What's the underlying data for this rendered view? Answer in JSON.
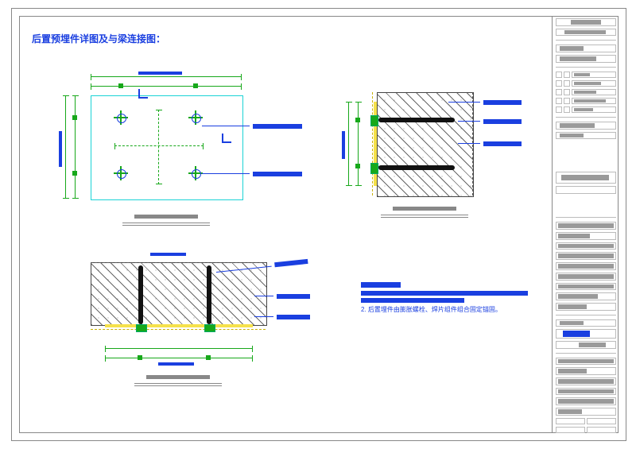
{
  "heading": "后置预埋件详图及与梁连接图：",
  "figA": {
    "caption_key": "plan_view_caption",
    "bolts": [
      "bolt-1",
      "bolt-2",
      "bolt-3",
      "bolt-4"
    ],
    "dim_top_label_key": "A_width",
    "dim_left_label_key": "A_height",
    "leaders": [
      "plate_label",
      "bolt_label"
    ]
  },
  "figB": {
    "caption_key": "side_section_caption",
    "leaders": [
      "anchor_label",
      "plate_label",
      "concrete_label"
    ]
  },
  "figC": {
    "caption_key": "bottom_section_caption",
    "leaders": [
      "anchor_label",
      "plate_label",
      "concrete_label"
    ]
  },
  "notes": {
    "title_key": "notes_heading",
    "item2": "2. 后置埋件由膨胀螺栓、焊片组件组合固定锚固。"
  },
  "colors": {
    "dim_green": "#17a81a",
    "line_blue": "#1a3fe0",
    "plate_cyan": "#1bd3d6",
    "plate_yellow": "#f6e24b"
  }
}
